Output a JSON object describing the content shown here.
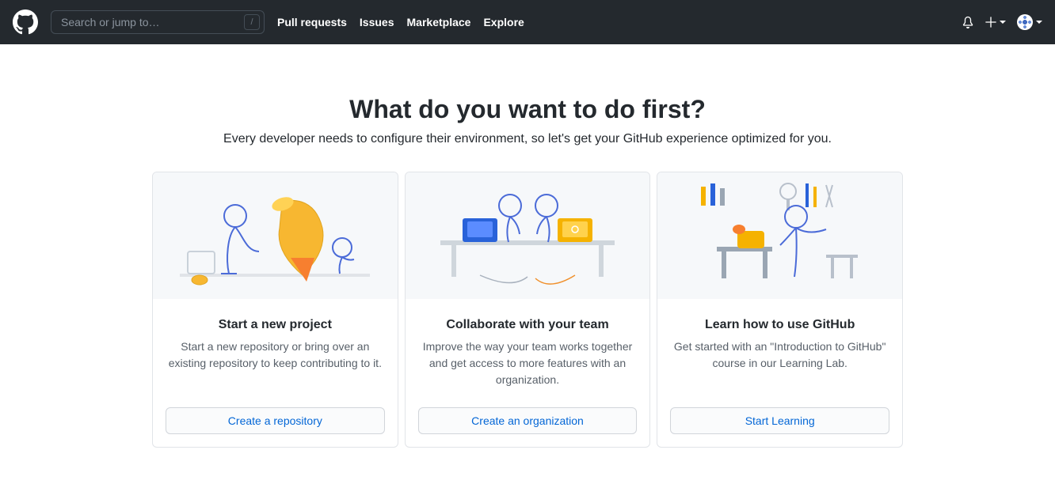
{
  "header": {
    "search_placeholder": "Search or jump to…",
    "slash_hint": "/",
    "nav": [
      "Pull requests",
      "Issues",
      "Marketplace",
      "Explore"
    ]
  },
  "page": {
    "title": "What do you want to do first?",
    "subtitle": "Every developer needs to configure their environment, so let's get your GitHub experience optimized for you."
  },
  "cards": [
    {
      "title": "Start a new project",
      "desc": "Start a new repository or bring over an existing repository to keep contributing to it.",
      "cta": "Create a repository"
    },
    {
      "title": "Collaborate with your team",
      "desc": "Improve the way your team works together and get access to more features with an organization.",
      "cta": "Create an organization"
    },
    {
      "title": "Learn how to use GitHub",
      "desc": "Get started with an \"Introduction to GitHub\" course in our Learning Lab.",
      "cta": "Start Learning"
    }
  ]
}
